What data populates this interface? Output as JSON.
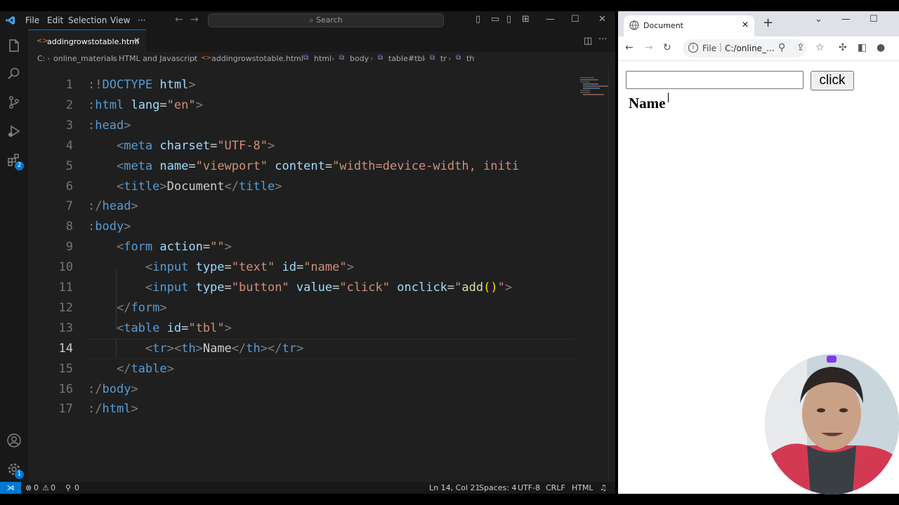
{
  "vscode": {
    "menu": [
      "File",
      "Edit",
      "Selection",
      "View",
      "···"
    ],
    "search_placeholder": "Search",
    "tab": {
      "filename": "addingrowstotable.html"
    },
    "breadcrumb": [
      "C:",
      "online_materials",
      "HTML and Javascript",
      "addingrowstotable.html",
      "html",
      "body",
      "table#tbl",
      "tr",
      "th"
    ],
    "extensions_badge": "2",
    "settings_badge": "1",
    "line_numbers": [
      "1",
      "2",
      "3",
      "4",
      "5",
      "6",
      "7",
      "8",
      "9",
      "10",
      "11",
      "12",
      "13",
      "14",
      "15",
      "16",
      "17"
    ],
    "current_line": 14,
    "code_lines": [
      [
        [
          "t",
          ":!"
        ],
        [
          "tg",
          "DOCTYPE"
        ],
        [
          "tx",
          " "
        ],
        [
          "at",
          "html"
        ],
        [
          "t",
          ">"
        ]
      ],
      [
        [
          "t",
          ":"
        ],
        [
          "tg",
          "html"
        ],
        [
          "tx",
          " "
        ],
        [
          "at",
          "lang"
        ],
        [
          "tx",
          "="
        ],
        [
          "st",
          "\"en\""
        ],
        [
          "t",
          ">"
        ]
      ],
      [
        [
          "t",
          ":"
        ],
        [
          "tg",
          "head"
        ],
        [
          "t",
          ">"
        ]
      ],
      [
        [
          "tx",
          "    "
        ],
        [
          "t",
          "<"
        ],
        [
          "tg",
          "meta"
        ],
        [
          "tx",
          " "
        ],
        [
          "at",
          "charset"
        ],
        [
          "tx",
          "="
        ],
        [
          "st",
          "\"UTF-8\""
        ],
        [
          "t",
          ">"
        ]
      ],
      [
        [
          "tx",
          "    "
        ],
        [
          "t",
          "<"
        ],
        [
          "tg",
          "meta"
        ],
        [
          "tx",
          " "
        ],
        [
          "at",
          "name"
        ],
        [
          "tx",
          "="
        ],
        [
          "st",
          "\"viewport\""
        ],
        [
          "tx",
          " "
        ],
        [
          "at",
          "content"
        ],
        [
          "tx",
          "="
        ],
        [
          "st",
          "\"width=device-width, initi"
        ]
      ],
      [
        [
          "tx",
          "    "
        ],
        [
          "t",
          "<"
        ],
        [
          "tg",
          "title"
        ],
        [
          "t",
          ">"
        ],
        [
          "tx",
          "Document"
        ],
        [
          "t",
          "</"
        ],
        [
          "tg",
          "title"
        ],
        [
          "t",
          ">"
        ]
      ],
      [
        [
          "t",
          ":/"
        ],
        [
          "tg",
          "head"
        ],
        [
          "t",
          ">"
        ]
      ],
      [
        [
          "t",
          ":"
        ],
        [
          "tg",
          "body"
        ],
        [
          "t",
          ">"
        ]
      ],
      [
        [
          "tx",
          "    "
        ],
        [
          "t",
          "<"
        ],
        [
          "tg",
          "form"
        ],
        [
          "tx",
          " "
        ],
        [
          "at",
          "action"
        ],
        [
          "tx",
          "="
        ],
        [
          "st",
          "\"\""
        ],
        [
          "t",
          ">"
        ]
      ],
      [
        [
          "tx",
          "        "
        ],
        [
          "t",
          "<"
        ],
        [
          "tg",
          "input"
        ],
        [
          "tx",
          " "
        ],
        [
          "at",
          "type"
        ],
        [
          "tx",
          "="
        ],
        [
          "st",
          "\"text\""
        ],
        [
          "tx",
          " "
        ],
        [
          "at",
          "id"
        ],
        [
          "tx",
          "="
        ],
        [
          "st",
          "\"name\""
        ],
        [
          "t",
          ">"
        ]
      ],
      [
        [
          "tx",
          "        "
        ],
        [
          "t",
          "<"
        ],
        [
          "tg",
          "input"
        ],
        [
          "tx",
          " "
        ],
        [
          "at",
          "type"
        ],
        [
          "tx",
          "="
        ],
        [
          "st",
          "\"button\""
        ],
        [
          "tx",
          " "
        ],
        [
          "at",
          "value"
        ],
        [
          "tx",
          "="
        ],
        [
          "st",
          "\"click\""
        ],
        [
          "tx",
          " "
        ],
        [
          "at",
          "onclick"
        ],
        [
          "tx",
          "="
        ],
        [
          "st",
          "\""
        ],
        [
          "fn",
          "add"
        ],
        [
          "br",
          "()"
        ],
        [
          "st",
          "\""
        ],
        [
          "t",
          ">"
        ]
      ],
      [
        [
          "tx",
          "    "
        ],
        [
          "t",
          "</"
        ],
        [
          "tg",
          "form"
        ],
        [
          "t",
          ">"
        ]
      ],
      [
        [
          "tx",
          "    "
        ],
        [
          "t",
          "<"
        ],
        [
          "tg",
          "table"
        ],
        [
          "tx",
          " "
        ],
        [
          "at",
          "id"
        ],
        [
          "tx",
          "="
        ],
        [
          "st",
          "\"tbl\""
        ],
        [
          "t",
          ">"
        ]
      ],
      [
        [
          "tx",
          "        "
        ],
        [
          "t",
          "<"
        ],
        [
          "tg",
          "tr"
        ],
        [
          "t",
          "><"
        ],
        [
          "tg",
          "th"
        ],
        [
          "t",
          ">"
        ],
        [
          "tx",
          "Name"
        ],
        [
          "t",
          "</"
        ],
        [
          "tg",
          "th"
        ],
        [
          "t",
          "></"
        ],
        [
          "tg",
          "tr"
        ],
        [
          "t",
          ">"
        ]
      ],
      [
        [
          "tx",
          "    "
        ],
        [
          "t",
          "</"
        ],
        [
          "tg",
          "table"
        ],
        [
          "t",
          ">"
        ]
      ],
      [
        [
          "t",
          ":/"
        ],
        [
          "tg",
          "body"
        ],
        [
          "t",
          ">"
        ]
      ],
      [
        [
          "t",
          ":/"
        ],
        [
          "tg",
          "html"
        ],
        [
          "t",
          ">"
        ]
      ]
    ],
    "status": {
      "errors": "0",
      "warnings": "0",
      "ports": "0",
      "position": "Ln 14, Col 21",
      "spaces": "Spaces: 4",
      "encoding": "UTF-8",
      "eol": "CRLF",
      "language": "HTML"
    }
  },
  "browser": {
    "tab_title": "Document",
    "omnibox": {
      "scheme": "File",
      "url": "C:/online_..."
    },
    "page": {
      "button_label": "click",
      "table_header": "Name",
      "input_value": ""
    }
  }
}
